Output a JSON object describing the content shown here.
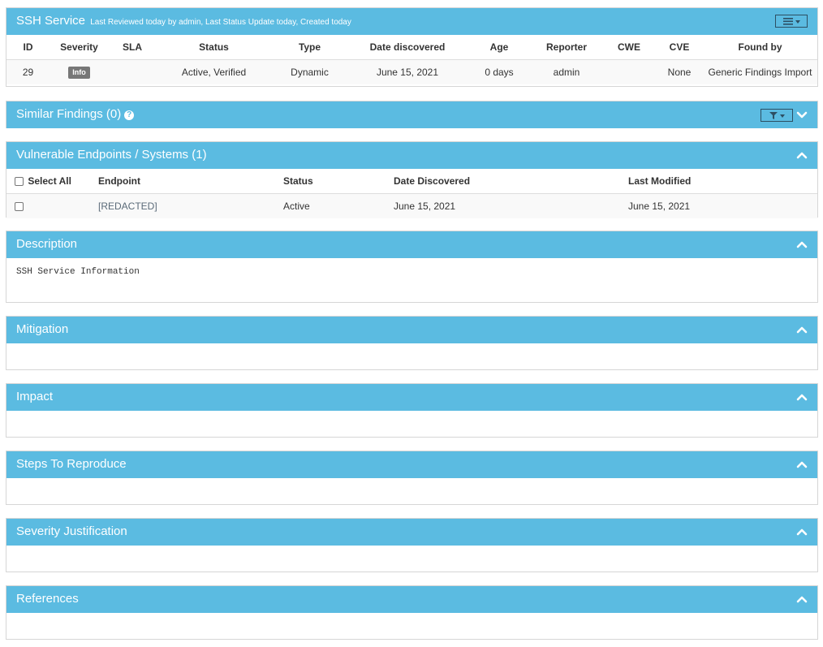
{
  "finding": {
    "title": "SSH Service",
    "subtitle": "Last Reviewed today by admin, Last Status Update today, Created today",
    "columns": [
      "ID",
      "Severity",
      "SLA",
      "Status",
      "Type",
      "Date discovered",
      "Age",
      "Reporter",
      "CWE",
      "CVE",
      "Found by"
    ],
    "row": {
      "id": "29",
      "severity": "Info",
      "sla": "",
      "status": "Active, Verified",
      "type": "Dynamic",
      "date_discovered": "June 15, 2021",
      "age": "0 days",
      "reporter": "admin",
      "cwe": "",
      "cve": "None",
      "found_by": "Generic Findings Import"
    },
    "icons": {
      "menu": "hamburger-menu-icon",
      "caret": "caret-down-icon"
    }
  },
  "similar": {
    "title": "Similar Findings (0)",
    "help": "?",
    "icons": {
      "filter": "filter-icon",
      "toggle": "chevron-down-icon"
    }
  },
  "endpoints": {
    "title": "Vulnerable Endpoints / Systems (1)",
    "columns": {
      "select_all": "Select All",
      "endpoint": "Endpoint",
      "status": "Status",
      "date_discovered": "Date Discovered",
      "last_modified": "Last Modified"
    },
    "rows": [
      {
        "endpoint": "[REDACTED]",
        "status": "Active",
        "date_discovered": "June 15, 2021",
        "last_modified": "June 15, 2021"
      }
    ]
  },
  "sections": {
    "description": {
      "title": "Description",
      "body": "SSH Service Information"
    },
    "mitigation": {
      "title": "Mitigation",
      "body": ""
    },
    "impact": {
      "title": "Impact",
      "body": ""
    },
    "steps": {
      "title": "Steps To Reproduce",
      "body": ""
    },
    "severity_justification": {
      "title": "Severity Justification",
      "body": ""
    },
    "references": {
      "title": "References",
      "body": ""
    }
  },
  "colors": {
    "header_bg": "#5bbbe1",
    "header_text": "#ffffff",
    "badge_bg": "#777777"
  }
}
